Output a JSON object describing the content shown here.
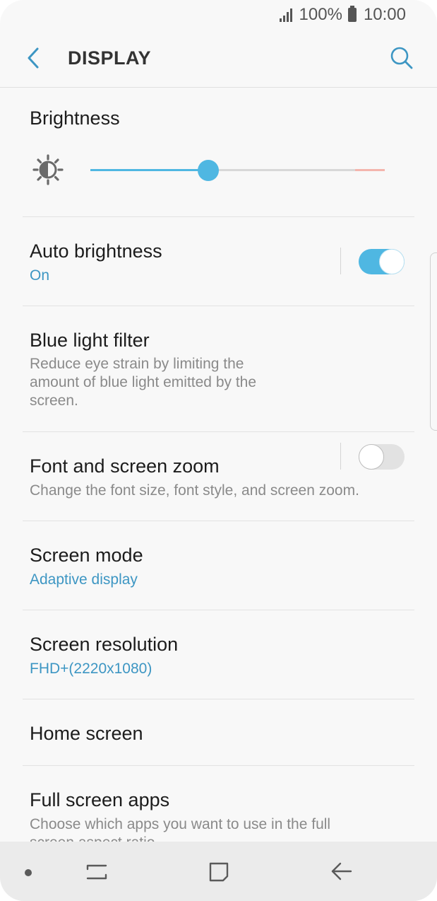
{
  "status_bar": {
    "battery_text": "100%",
    "time": "10:00",
    "icons": [
      "signal-icon",
      "battery-icon"
    ]
  },
  "app_bar": {
    "title": "DISPLAY",
    "icons": [
      "back-arrow-icon",
      "search-icon"
    ]
  },
  "brightness": {
    "title": "Brightness",
    "level": 0.4,
    "icon": "brightness-sun-icon"
  },
  "settings": [
    {
      "title": "Auto brightness",
      "subtitle": "On",
      "toggle": true
    },
    {
      "title": "Blue light filter",
      "subtitle": "Reduce eye strain by limiting the amount of blue light emitted by the screen.",
      "toggle": false
    },
    {
      "title": "Font and screen zoom",
      "subtitle": "Change the font size, font style, and screen zoom."
    },
    {
      "title": "Screen mode",
      "subtitle": "Adaptive display"
    },
    {
      "title": "Screen resolution",
      "subtitle": "FHD+(2220x1080)"
    },
    {
      "title": "Home screen"
    },
    {
      "title": "Full screen apps",
      "subtitle": "Choose which apps you want to use in the full screen aspect ratio."
    }
  ],
  "colors": {
    "accent": "#4fb7e2",
    "accent_text": "#3d96c3",
    "background": "#f8f8f8",
    "nav_background": "#ebebeb"
  },
  "nav_bar": {
    "icons": [
      "nav-dot-icon",
      "recents-icon",
      "home-icon",
      "back-icon"
    ]
  }
}
